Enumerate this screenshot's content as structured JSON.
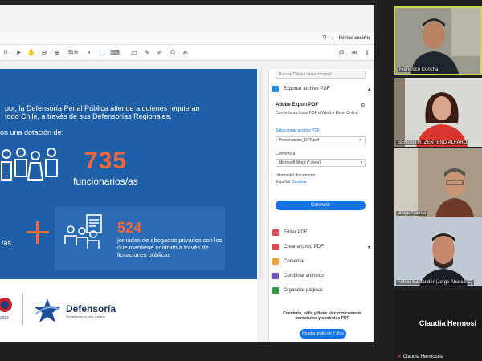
{
  "viewer": {
    "menu": {
      "help_icon": "help-icon",
      "bell_icon": "bell-icon",
      "signin_label": "Iniciar sesión"
    },
    "toolbar": {
      "zoom_value": "51%"
    }
  },
  "slide": {
    "line1": "por, la Defensoría Penal Pública atiende a quienes requieran",
    "line2": "todo Chile, a través de sus Defensorías Regionales.",
    "line3": "on una dotación de:",
    "stat1_value": "735",
    "stat1_label": "funcionarios/as",
    "left_fragment": "/as",
    "stat2_value": "524",
    "stat2_text": "jornadas de abogados privados con los que mantiene contrato a través de licitaciones públicas",
    "logo_year": "2021",
    "logo_brand": "Defensoría",
    "logo_tagline": "Sin defensa no hay Justicia",
    "colors": {
      "blue": "#1f5fa8",
      "orange": "#f2683c"
    }
  },
  "pane": {
    "search_placeholder": "Buscar 'Dibujar un rectángulo'",
    "export_header": "Exportar archivo PDF",
    "export_title": "Adobe Export PDF",
    "export_desc": "Convertir archivos PDF a Word o Excel Online",
    "select_label": "Seleccionar archivo PDF",
    "selected_file": "Presentacion_DPP.pdf",
    "convert_to_label": "Convertir a",
    "format_value": "Microsoft Word (*.docx)",
    "doc_lang_label": "Idioma del documento:",
    "doc_lang_value": "Español",
    "change_link": "Cambiar",
    "convert_button": "Convertir",
    "tools": [
      {
        "label": "Editar PDF",
        "color": "#e34850"
      },
      {
        "label": "Crear archivo PDF",
        "color": "#e34850"
      },
      {
        "label": "Comentar",
        "color": "#f0a030"
      },
      {
        "label": "Combinar archivos",
        "color": "#6e4fd2"
      },
      {
        "label": "Organizar páginas",
        "color": "#2ea043"
      }
    ],
    "promo_text": "Convierta, edite y firme electrónicamente formularios y contratos PDF",
    "trial_button": "Prueba gratis de 7 días"
  },
  "participants": [
    {
      "name": "Francisco Concha"
    },
    {
      "name": "SERGIO R. ZENTENO ALFARO"
    },
    {
      "name": "Jorge Abarca"
    },
    {
      "name": "Felipe Santander (Jorge Abarca C)"
    },
    {
      "name": "Claudia Hermosilla",
      "tile_name": "Claudia Hermosi"
    }
  ]
}
